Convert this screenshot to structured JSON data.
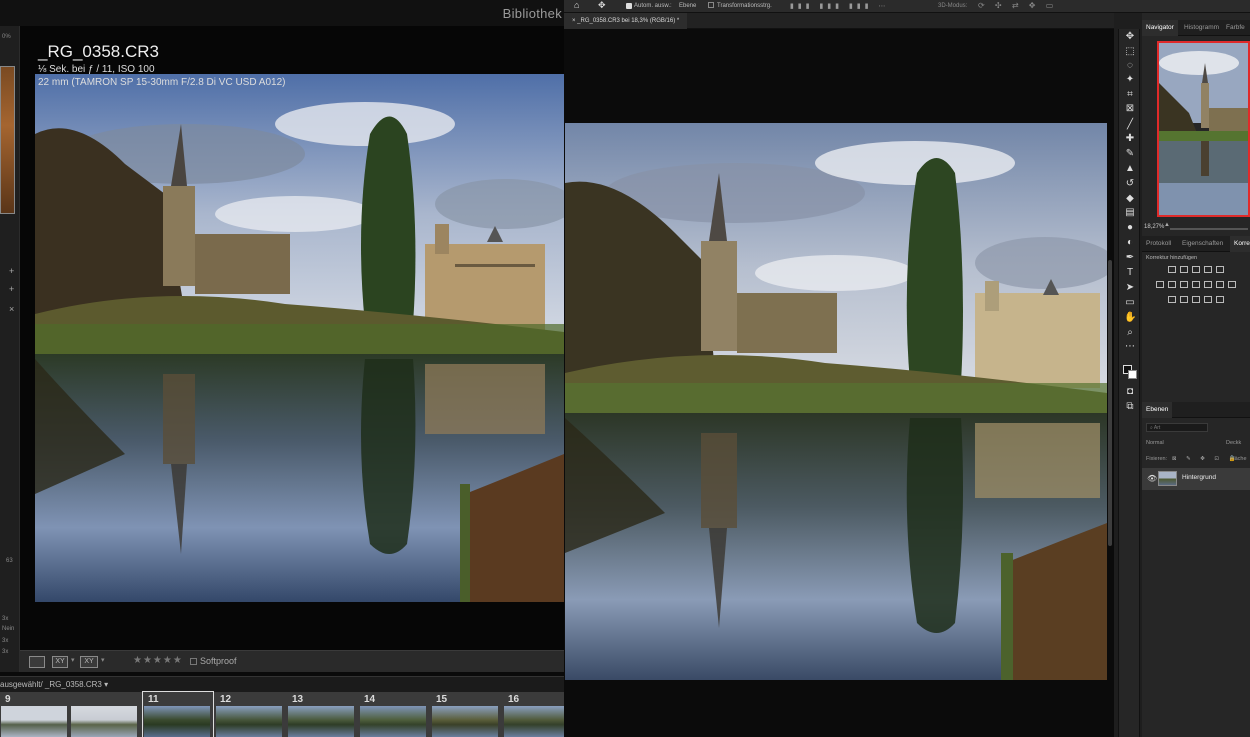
{
  "lightroom": {
    "module": "Bibliothek",
    "filename": "_RG_0358.CR3",
    "exif_line1": "⅛ Sek. bei ƒ / 11, ISO 100",
    "exif_line2": "22 mm (TAMRON SP 15-30mm F/2.8 Di VC USD A012)",
    "toolbar": {
      "view_btn1": "",
      "view_btn2": "XY",
      "view_btn3": "XY",
      "rating": "★★★★★",
      "softproof": "Softproof"
    },
    "filmstrip": {
      "path_label": "ausgewählt/ _RG_0358.CR3 ▾",
      "frames": [
        "9",
        "",
        "11",
        "12",
        "13",
        "14",
        "15",
        "16"
      ]
    },
    "left_panel_texts": [
      "0%",
      "63",
      "3x",
      "Nein",
      "3x",
      "3x"
    ]
  },
  "photoshop": {
    "options_bar": {
      "auto_select": "Autom. ausw.:",
      "layer_select": "Ebene",
      "transform": "Transformationsstrg.",
      "mode_3d": "3D-Modus:"
    },
    "doc_tab": "_RG_0358.CR3 bei 18,3% (RGB/16) *",
    "panels": {
      "top_tabs": [
        "Navigator",
        "Histogramm",
        "Farbfe"
      ],
      "zoom": "18,27%",
      "mid_tabs": [
        "Protokoll",
        "Eigenschaften",
        "Korre"
      ],
      "korrektur_label": "Korrektur hinzufügen",
      "layers_tab": "Ebenen",
      "layer_search": "Art",
      "blend_mode": "Normal",
      "opacity_label": "Deckk",
      "lock_label": "Fixieren:",
      "fill_label": "Fläche",
      "layer_name": "Hintergrund"
    }
  }
}
